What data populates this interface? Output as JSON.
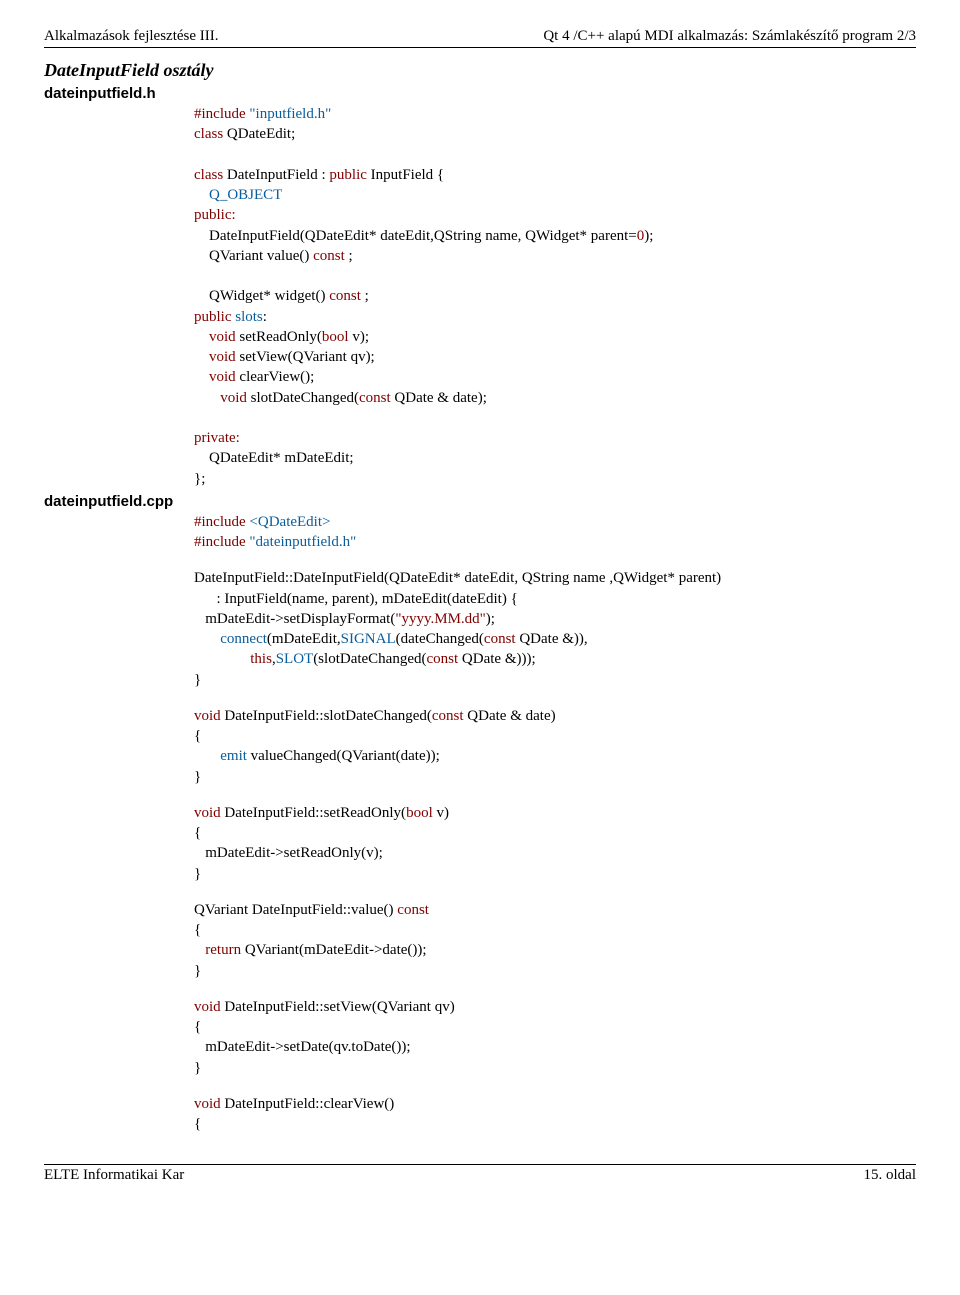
{
  "header": {
    "left": "Alkalmazások fejlesztése III.",
    "right": "Qt 4 /C++ alapú MDI alkalmazás: Számlakészítő program 2/3"
  },
  "section_title": "DateInputField osztály",
  "file_h": "dateinputfield.h",
  "file_cpp": "dateinputfield.cpp",
  "code": {
    "inc1_pre": "#include",
    "inc1_target": "\"inputfield.h\"",
    "class_kw": "class",
    "class1_rest": " QDateEdit;",
    "class2_head": " DateInputField : ",
    "public_kw": "public",
    "class2_rest": " InputField {",
    "qobject": "Q_OBJECT",
    "public_colon": "public:",
    "ctor_h": "    DateInputField(QDateEdit* dateEdit,QString name, QWidget* parent=",
    "zero": "0",
    "ctor_h_tail": ");",
    "value_h_head": "    QVariant value() ",
    "const_kw": "const",
    "semicolon_space": " ;",
    "widget_h_head": "    QWidget* widget() ",
    "public_slots_pre": "public",
    "public_slots_mid": " ",
    "slots_kw": "slots",
    "colon": ":",
    "void_kw": "void",
    "setReadOnly_h": " setReadOnly(",
    "bool_kw": "bool",
    "setReadOnly_h_tail": " v);",
    "setView_h": " setView(QVariant qv);",
    "clearView_h": " clearView();",
    "slotDateChanged_h": " slotDateChanged(",
    "slotDateChanged_h_tail": " QDate & date);",
    "private_kw": "private:",
    "member": "    QDateEdit* mDateEdit;",
    "close_class": "};",
    "inc2_pre": "#include",
    "inc2_target": " <QDateEdit>",
    "inc3_pre": "#include",
    "inc3_target": " \"dateinputfield.h\"",
    "ctor_cpp_l1": "DateInputField::DateInputField(QDateEdit* dateEdit, QString name ,QWidget* parent)",
    "ctor_cpp_l2": "      : InputField(name, parent), mDateEdit(dateEdit) {",
    "ctor_cpp_l3_head": "   mDateEdit->setDisplayFormat(",
    "ctor_cpp_l3_str": "\"yyyy.MM.dd\"",
    "ctor_cpp_l3_tail": ");",
    "connect_kw": "connect",
    "ctor_cpp_l4_head": "(mDateEdit,",
    "signal_kw": "SIGNAL",
    "ctor_cpp_l4_mid": "(dateChanged(",
    "ctor_cpp_l4_tail": " QDate &)),",
    "this_kw": "this",
    "ctor_cpp_l5_head": ",",
    "slot_kw": "SLOT",
    "ctor_cpp_l5_mid": "(slotDateChanged(",
    "ctor_cpp_l5_tail": " QDate &)));",
    "close_brace": "}",
    "fn_slotDateChanged_head": " DateInputField::slotDateChanged(",
    "fn_slotDateChanged_tail": " QDate & date)",
    "open_brace": "{",
    "emit_kw": "emit",
    "emit_rest": " valueChanged(QVariant(date));",
    "fn_setReadOnly_head": " DateInputField::setReadOnly(",
    "fn_setReadOnly_tail": " v)",
    "fn_setReadOnly_body": "   mDateEdit->setReadOnly(v);",
    "fn_value_head": "QVariant DateInputField::value() ",
    "return_kw": "return",
    "fn_value_body": " QVariant(mDateEdit->date());",
    "fn_setView_head": " DateInputField::setView(QVariant qv)",
    "fn_setView_body": "   mDateEdit->setDate(qv.toDate());",
    "fn_clearView_head": " DateInputField::clearView()"
  },
  "footer": {
    "left": "ELTE Informatikai Kar",
    "right": "15. oldal"
  }
}
